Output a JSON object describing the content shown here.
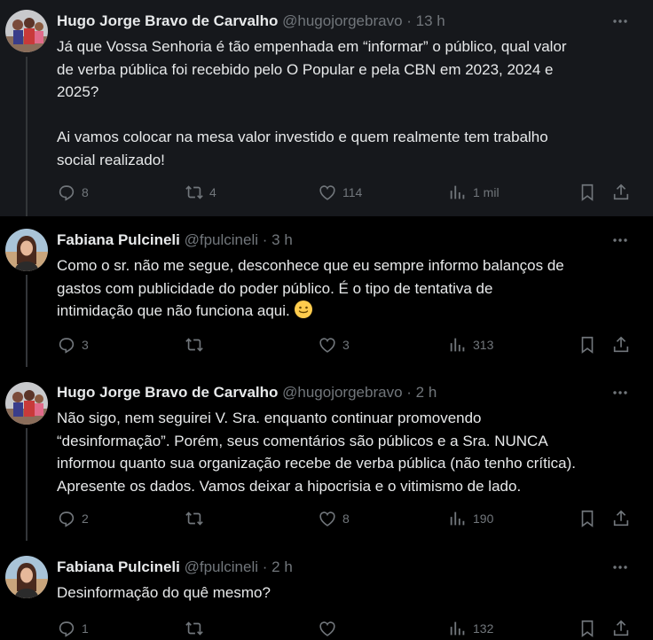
{
  "tweets": [
    {
      "name": "Hugo Jorge Bravo de Carvalho",
      "handle": "@hugojorgebravo",
      "time": "13 h",
      "text": "Já que Vossa Senhoria é tão empenhada em “informar” o público, qual valor\nde verba pública foi recebido pelo O Popular e pela CBN em 2023, 2024 e\n2025?\n\nAi vamos colocar na mesa valor investido e quem realmente tem trabalho\nsocial realizado!",
      "replies": "8",
      "reposts": "4",
      "likes": "114",
      "views": "1 mil",
      "avatar": "group-photo"
    },
    {
      "name": "Fabiana Pulcineli",
      "handle": "@fpulcineli",
      "time": "3 h",
      "text": "Como o sr. não me segue, desconhece que eu sempre informo balanços de\ngastos com publicidade do poder público. É o tipo de tentativa de\nintimidação que não funciona aqui.",
      "emoji": "slightly-smiling-face",
      "replies": "3",
      "reposts": "",
      "likes": "3",
      "views": "313",
      "avatar": "woman-photo"
    },
    {
      "name": "Hugo Jorge Bravo de Carvalho",
      "handle": "@hugojorgebravo",
      "time": "2 h",
      "text": "Não sigo, nem seguirei V. Sra. enquanto continuar promovendo\n“desinformação”. Porém, seus comentários são públicos e a Sra. NUNCA\ninformou quanto sua organização recebe de verba pública (não tenho crítica).\nApresente os dados. Vamos deixar a hipocrisia e o vitimismo de lado.",
      "replies": "2",
      "reposts": "",
      "likes": "8",
      "views": "190",
      "avatar": "group-photo"
    },
    {
      "name": "Fabiana Pulcineli",
      "handle": "@fpulcineli",
      "time": "2 h",
      "text": "Desinformação do quê mesmo?",
      "replies": "1",
      "reposts": "",
      "likes": "",
      "views": "132",
      "avatar": "woman-photo"
    }
  ],
  "separator": "·",
  "colors": {
    "background": "#000000",
    "highlight": "#16181c",
    "text": "#e7e9ea",
    "muted": "#71767b",
    "line": "#333639"
  }
}
